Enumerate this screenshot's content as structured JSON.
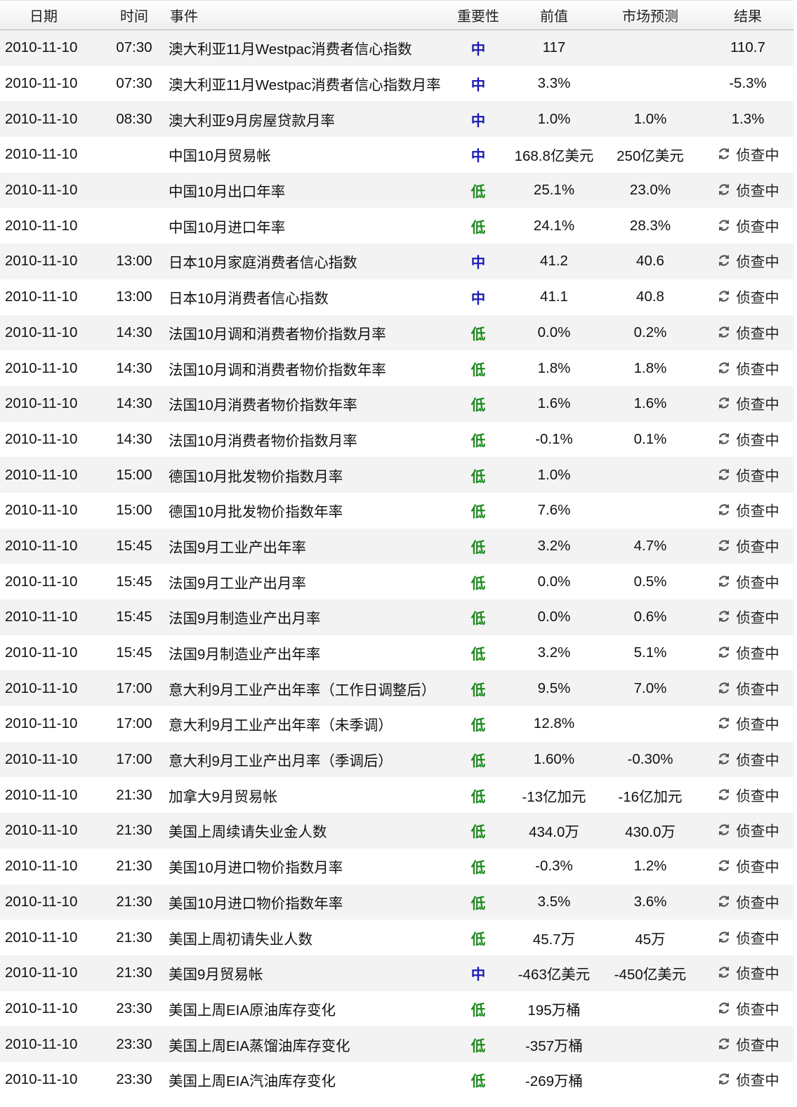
{
  "headers": {
    "date": "日期",
    "time": "时间",
    "event": "事件",
    "importance": "重要性",
    "previous": "前值",
    "forecast": "市场预测",
    "result": "结果"
  },
  "pending_label": "侦查中",
  "colors": {
    "importance_mid": "#1a1ab8",
    "importance_low": "#1d8a1d",
    "row_alt": "#f3f3f3"
  },
  "rows": [
    {
      "date": "2010-11-10",
      "time": "07:30",
      "event": "澳大利亚11月Westpac消费者信心指数",
      "importance": "中",
      "previous": "117",
      "forecast": "",
      "result": "110.7"
    },
    {
      "date": "2010-11-10",
      "time": "07:30",
      "event": "澳大利亚11月Westpac消费者信心指数月率",
      "importance": "中",
      "previous": "3.3%",
      "forecast": "",
      "result": "-5.3%"
    },
    {
      "date": "2010-11-10",
      "time": "08:30",
      "event": "澳大利亚9月房屋贷款月率",
      "importance": "中",
      "previous": "1.0%",
      "forecast": "1.0%",
      "result": "1.3%"
    },
    {
      "date": "2010-11-10",
      "time": "",
      "event": "中国10月贸易帐",
      "importance": "中",
      "previous": "168.8亿美元",
      "forecast": "250亿美元",
      "result": ""
    },
    {
      "date": "2010-11-10",
      "time": "",
      "event": "中国10月出口年率",
      "importance": "低",
      "previous": "25.1%",
      "forecast": "23.0%",
      "result": ""
    },
    {
      "date": "2010-11-10",
      "time": "",
      "event": "中国10月进口年率",
      "importance": "低",
      "previous": "24.1%",
      "forecast": "28.3%",
      "result": ""
    },
    {
      "date": "2010-11-10",
      "time": "13:00",
      "event": "日本10月家庭消费者信心指数",
      "importance": "中",
      "previous": "41.2",
      "forecast": "40.6",
      "result": ""
    },
    {
      "date": "2010-11-10",
      "time": "13:00",
      "event": "日本10月消费者信心指数",
      "importance": "中",
      "previous": "41.1",
      "forecast": "40.8",
      "result": ""
    },
    {
      "date": "2010-11-10",
      "time": "14:30",
      "event": "法国10月调和消费者物价指数月率",
      "importance": "低",
      "previous": "0.0%",
      "forecast": "0.2%",
      "result": ""
    },
    {
      "date": "2010-11-10",
      "time": "14:30",
      "event": "法国10月调和消费者物价指数年率",
      "importance": "低",
      "previous": "1.8%",
      "forecast": "1.8%",
      "result": ""
    },
    {
      "date": "2010-11-10",
      "time": "14:30",
      "event": "法国10月消费者物价指数年率",
      "importance": "低",
      "previous": "1.6%",
      "forecast": "1.6%",
      "result": ""
    },
    {
      "date": "2010-11-10",
      "time": "14:30",
      "event": "法国10月消费者物价指数月率",
      "importance": "低",
      "previous": "-0.1%",
      "forecast": "0.1%",
      "result": ""
    },
    {
      "date": "2010-11-10",
      "time": "15:00",
      "event": "德国10月批发物价指数月率",
      "importance": "低",
      "previous": "1.0%",
      "forecast": "",
      "result": ""
    },
    {
      "date": "2010-11-10",
      "time": "15:00",
      "event": "德国10月批发物价指数年率",
      "importance": "低",
      "previous": "7.6%",
      "forecast": "",
      "result": ""
    },
    {
      "date": "2010-11-10",
      "time": "15:45",
      "event": "法国9月工业产出年率",
      "importance": "低",
      "previous": "3.2%",
      "forecast": "4.7%",
      "result": ""
    },
    {
      "date": "2010-11-10",
      "time": "15:45",
      "event": "法国9月工业产出月率",
      "importance": "低",
      "previous": "0.0%",
      "forecast": "0.5%",
      "result": ""
    },
    {
      "date": "2010-11-10",
      "time": "15:45",
      "event": "法国9月制造业产出月率",
      "importance": "低",
      "previous": "0.0%",
      "forecast": "0.6%",
      "result": ""
    },
    {
      "date": "2010-11-10",
      "time": "15:45",
      "event": "法国9月制造业产出年率",
      "importance": "低",
      "previous": "3.2%",
      "forecast": "5.1%",
      "result": ""
    },
    {
      "date": "2010-11-10",
      "time": "17:00",
      "event": "意大利9月工业产出年率（工作日调整后）",
      "importance": "低",
      "previous": "9.5%",
      "forecast": "7.0%",
      "result": ""
    },
    {
      "date": "2010-11-10",
      "time": "17:00",
      "event": "意大利9月工业产出年率（未季调）",
      "importance": "低",
      "previous": "12.8%",
      "forecast": "",
      "result": ""
    },
    {
      "date": "2010-11-10",
      "time": "17:00",
      "event": "意大利9月工业产出月率（季调后）",
      "importance": "低",
      "previous": "1.60%",
      "forecast": "-0.30%",
      "result": ""
    },
    {
      "date": "2010-11-10",
      "time": "21:30",
      "event": "加拿大9月贸易帐",
      "importance": "低",
      "previous": "-13亿加元",
      "forecast": "-16亿加元",
      "result": ""
    },
    {
      "date": "2010-11-10",
      "time": "21:30",
      "event": "美国上周续请失业金人数",
      "importance": "低",
      "previous": "434.0万",
      "forecast": "430.0万",
      "result": ""
    },
    {
      "date": "2010-11-10",
      "time": "21:30",
      "event": "美国10月进口物价指数月率",
      "importance": "低",
      "previous": "-0.3%",
      "forecast": "1.2%",
      "result": ""
    },
    {
      "date": "2010-11-10",
      "time": "21:30",
      "event": "美国10月进口物价指数年率",
      "importance": "低",
      "previous": "3.5%",
      "forecast": "3.6%",
      "result": ""
    },
    {
      "date": "2010-11-10",
      "time": "21:30",
      "event": "美国上周初请失业人数",
      "importance": "低",
      "previous": "45.7万",
      "forecast": "45万",
      "result": ""
    },
    {
      "date": "2010-11-10",
      "time": "21:30",
      "event": "美国9月贸易帐",
      "importance": "中",
      "previous": "-463亿美元",
      "forecast": "-450亿美元",
      "result": ""
    },
    {
      "date": "2010-11-10",
      "time": "23:30",
      "event": "美国上周EIA原油库存变化",
      "importance": "低",
      "previous": "195万桶",
      "forecast": "",
      "result": ""
    },
    {
      "date": "2010-11-10",
      "time": "23:30",
      "event": "美国上周EIA蒸馏油库存变化",
      "importance": "低",
      "previous": "-357万桶",
      "forecast": "",
      "result": ""
    },
    {
      "date": "2010-11-10",
      "time": "23:30",
      "event": "美国上周EIA汽油库存变化",
      "importance": "低",
      "previous": "-269万桶",
      "forecast": "",
      "result": ""
    }
  ]
}
